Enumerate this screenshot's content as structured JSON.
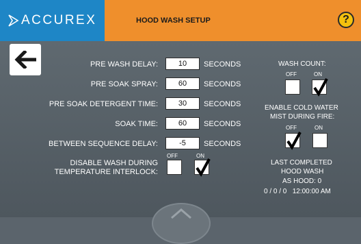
{
  "header": {
    "brand": "ACCURE X",
    "brand_text": "ACCUREX",
    "title": "HOOD WASH SETUP",
    "help": "?"
  },
  "settings": [
    {
      "label": "PRE WASH DELAY:",
      "value": "10",
      "unit": "SECONDS"
    },
    {
      "label": "PRE SOAK SPRAY:",
      "value": "60",
      "unit": "SECONDS"
    },
    {
      "label": "PRE SOAK DETERGENT TIME:",
      "value": "30",
      "unit": "SECONDS"
    },
    {
      "label": "SOAK TIME:",
      "value": "60",
      "unit": "SECONDS"
    },
    {
      "label": "BETWEEN SEQUENCE DELAY:",
      "value": "-5",
      "unit": "SECONDS"
    }
  ],
  "disable_wash": {
    "label_line1": "DISABLE WASH DURING",
    "label_line2": "TEMPERATURE INTERLOCK:",
    "off": "OFF",
    "on": "ON",
    "selected": "on"
  },
  "wash_count": {
    "label": "WASH COUNT:",
    "off": "OFF",
    "on": "ON",
    "selected": "on"
  },
  "cold_water": {
    "label_line1": "ENABLE COLD WATER",
    "label_line2": "MIST DURING FIRE:",
    "off": "OFF",
    "on": "ON",
    "selected": "off"
  },
  "last_completed": {
    "line1": "LAST COMPLETED",
    "line2": "HOOD WASH",
    "line3": "AS HOOD: 0",
    "line4": "0 / 0 / 0   12:00:00 AM"
  },
  "colors": {
    "header_orange": "#ef8f2c",
    "logo_blue": "#1e86c6",
    "background": "#5b646c",
    "help_yellow": "#f4c10e"
  },
  "icons": [
    "back-arrow-icon",
    "checkmark-icon",
    "home-icon"
  ]
}
